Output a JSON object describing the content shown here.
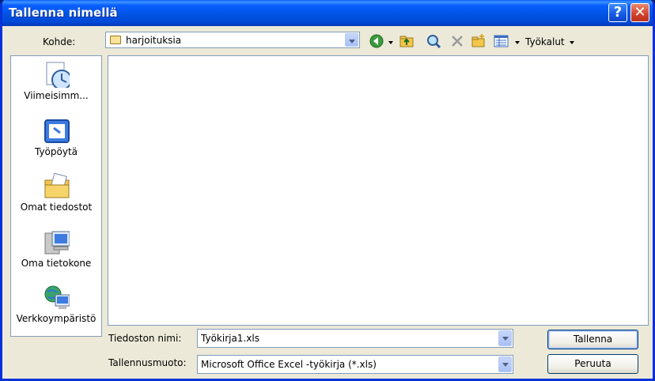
{
  "window": {
    "title": "Tallenna nimellä",
    "help_symbol": "?",
    "close_symbol": "✕"
  },
  "location": {
    "label": "Kohde:",
    "value": "harjoituksia"
  },
  "toolbar": {
    "tools_label": "Työkalut"
  },
  "places": [
    {
      "label": "Viimeisimm...",
      "icon": "recent-documents-icon"
    },
    {
      "label": "Työpöytä",
      "icon": "desktop-icon"
    },
    {
      "label": "Omat tiedostot",
      "icon": "my-documents-icon"
    },
    {
      "label": "Oma tietokone",
      "icon": "my-computer-icon"
    },
    {
      "label": "Verkkoympäristö",
      "icon": "network-places-icon"
    }
  ],
  "filename": {
    "label": "Tiedoston nimi:",
    "value": "Työkirja1.xls"
  },
  "filetype": {
    "label": "Tallennusmuoto:",
    "value": "Microsoft Office Excel -työkirja (*.xls)"
  },
  "buttons": {
    "save": "Tallenna",
    "cancel": "Peruuta"
  },
  "colors": {
    "titlebar": "#0054e3",
    "dialog_bg": "#ece9d8",
    "border": "#7f9db9"
  }
}
